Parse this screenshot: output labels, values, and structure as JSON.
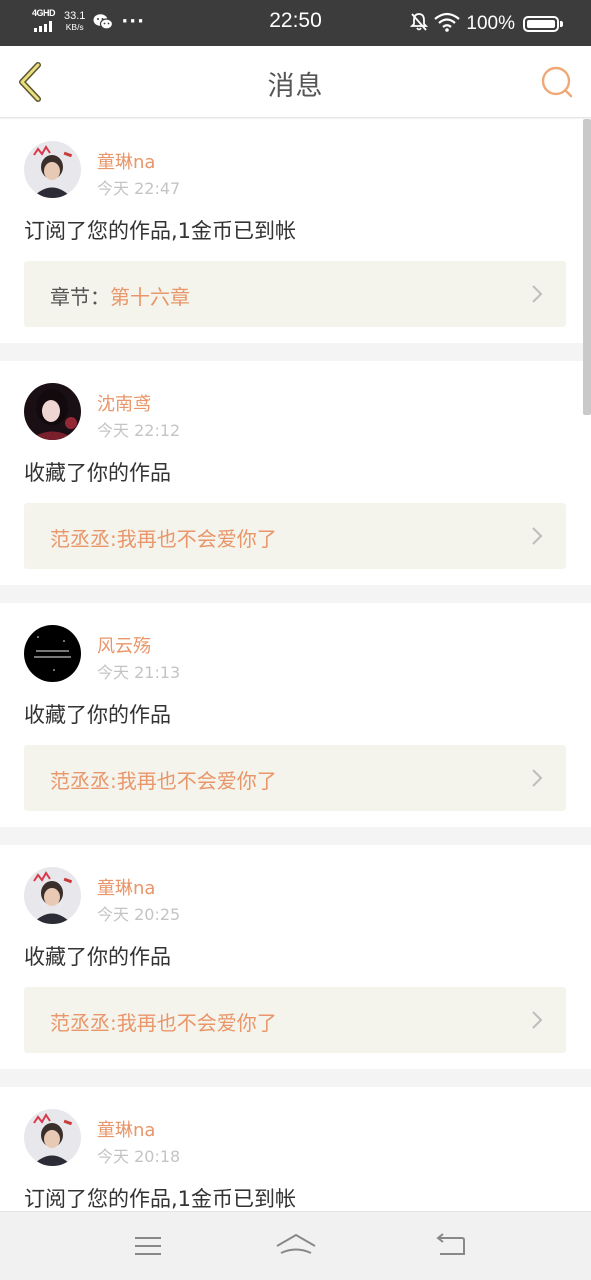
{
  "status_bar": {
    "network_type": "4GHD",
    "speed_value": "33.1",
    "speed_unit": "KB/s",
    "dots": "···",
    "time": "22:50",
    "battery": "100%",
    "icons": [
      "signal-icon",
      "wechat-icon",
      "mute-icon",
      "wifi-icon",
      "battery-icon"
    ]
  },
  "header": {
    "title": "消息",
    "back_icon": "chevron-left-icon",
    "search_icon": "search-icon",
    "accent_color": "#e8966a"
  },
  "messages": [
    {
      "username": "童琳na",
      "time": "今天 22:47",
      "action": "订阅了您的作品,1金币已到帐",
      "ref_label": "章节：",
      "ref_value": "第十六章",
      "avatar": "avatar-boy-crown"
    },
    {
      "username": "沈南鸢",
      "time": "今天 22:12",
      "action": "收藏了你的作品",
      "ref_label": "",
      "ref_value": "范丞丞:我再也不会爱你了",
      "avatar": "avatar-girl-dark"
    },
    {
      "username": "风云殇",
      "time": "今天 21:13",
      "action": "收藏了你的作品",
      "ref_label": "",
      "ref_value": "范丞丞:我再也不会爱你了",
      "avatar": "avatar-black-text"
    },
    {
      "username": "童琳na",
      "time": "今天 20:25",
      "action": "收藏了你的作品",
      "ref_label": "",
      "ref_value": "范丞丞:我再也不会爱你了",
      "avatar": "avatar-boy-crown"
    },
    {
      "username": "童琳na",
      "time": "今天 20:18",
      "action": "订阅了您的作品,1金币已到帐",
      "ref_label": "",
      "ref_value": "",
      "avatar": "avatar-boy-crown"
    }
  ],
  "nav_bar": {
    "icons": [
      "menu-icon",
      "home-icon",
      "back-icon"
    ]
  }
}
